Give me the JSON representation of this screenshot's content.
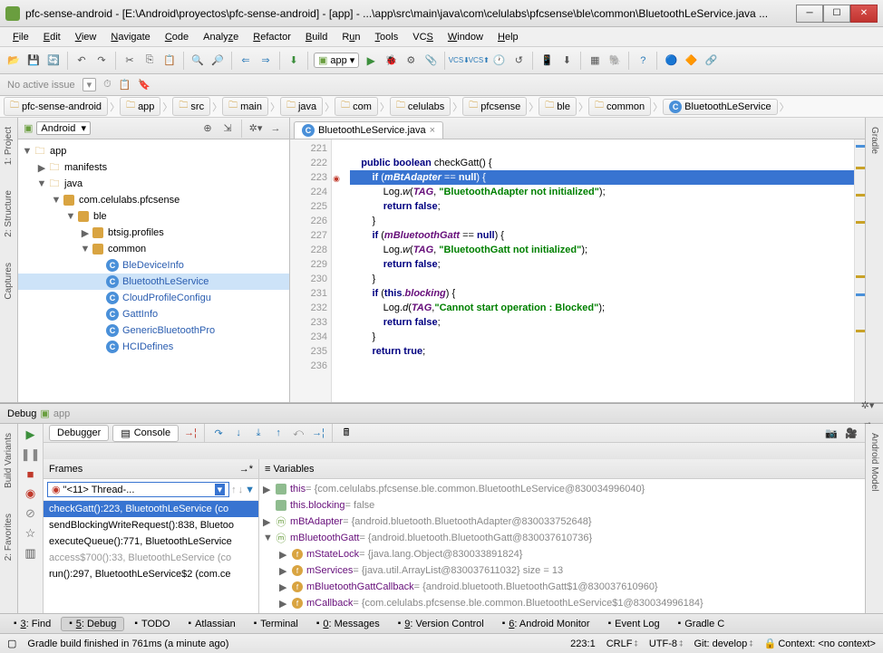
{
  "title": "pfc-sense-android - [E:\\Android\\proyectos\\pfc-sense-android] - [app] - ...\\app\\src\\main\\java\\com\\celulabs\\pfcsense\\ble\\common\\BluetoothLeService.java ...",
  "menu": [
    "File",
    "Edit",
    "View",
    "Navigate",
    "Code",
    "Analyze",
    "Refactor",
    "Build",
    "Run",
    "Tools",
    "VCS",
    "Window",
    "Help"
  ],
  "issue_text": "No active issue",
  "run_target": "app",
  "breadcrumbs": [
    "pfc-sense-android",
    "app",
    "src",
    "main",
    "java",
    "com",
    "celulabs",
    "pfcsense",
    "ble",
    "common",
    "BluetoothLeService"
  ],
  "project_view": "Android",
  "tree": {
    "root": "app",
    "manifests": "manifests",
    "java": "java",
    "pkg": "com.celulabs.pfcsense",
    "ble": "ble",
    "profiles": "btsig.profiles",
    "common": "common",
    "files": [
      "BleDeviceInfo",
      "BluetoothLeService",
      "CloudProfileConfigu",
      "GattInfo",
      "GenericBluetoothPro",
      "HCIDefines"
    ]
  },
  "editor_tab": "BluetoothLeService.java",
  "code_lines": [
    {
      "n": 221,
      "t": ""
    },
    {
      "n": 222,
      "t": "    public boolean checkGatt() {",
      "plain": true,
      "kw": [
        "public",
        "boolean"
      ]
    },
    {
      "n": 223,
      "t": "        if (mBtAdapter == null) {",
      "hl": true,
      "marked": true
    },
    {
      "n": 224,
      "t": "            Log.w(TAG, \"BluetoothAdapter not initialized\");",
      "log": true,
      "str": "\"BluetoothAdapter not initialized\""
    },
    {
      "n": 225,
      "t": "            return false;",
      "kw": [
        "return",
        "false"
      ]
    },
    {
      "n": 226,
      "t": "        }"
    },
    {
      "n": 227,
      "t": "        if (mBluetoothGatt == null) {",
      "kw": [
        "if",
        "null"
      ],
      "id": "mBluetoothGatt"
    },
    {
      "n": 228,
      "t": "            Log.w(TAG, \"BluetoothGatt not initialized\");",
      "log": true,
      "str": "\"BluetoothGatt not initialized\""
    },
    {
      "n": 229,
      "t": "            return false;",
      "kw": [
        "return",
        "false"
      ]
    },
    {
      "n": 230,
      "t": "        }"
    },
    {
      "n": 231,
      "t": "        if (this.blocking) {",
      "kw": [
        "if",
        "this"
      ],
      "id": "blocking"
    },
    {
      "n": 232,
      "t": "            Log.d(TAG,\"Cannot start operation : Blocked\");",
      "log": true,
      "str": "\"Cannot start operation : Blocked\""
    },
    {
      "n": 233,
      "t": "            return false;",
      "kw": [
        "return",
        "false"
      ]
    },
    {
      "n": 234,
      "t": "        }"
    },
    {
      "n": 235,
      "t": "        return true;",
      "kw": [
        "return",
        "true"
      ]
    },
    {
      "n": 236,
      "t": ""
    }
  ],
  "debug_title": "Debug",
  "debug_app": "app",
  "debug_tabs": {
    "debugger": "Debugger",
    "console": "Console"
  },
  "frames_title": "Frames",
  "vars_title": "Variables",
  "thread": "\"<11> Thread-...",
  "frames": [
    {
      "t": "checkGatt():223, BluetoothLeService (co",
      "sel": true
    },
    {
      "t": "sendBlockingWriteRequest():838, Bluetoo"
    },
    {
      "t": "executeQueue():771, BluetoothLeService"
    },
    {
      "t": "access$700():33, BluetoothLeService (co",
      "dis": true
    },
    {
      "t": "run():297, BluetoothLeService$2 (com.ce"
    }
  ],
  "vars": [
    {
      "ind": 0,
      "exp": "▶",
      "ic": "w",
      "n": "this",
      "v": " = {com.celulabs.pfcsense.ble.common.BluetoothLeService@830034996040}"
    },
    {
      "ind": 0,
      "exp": "",
      "ic": "w",
      "n": "this.blocking",
      "v": " = false"
    },
    {
      "ind": 0,
      "exp": "▶",
      "ic": "g",
      "n": "mBtAdapter",
      "v": " = {android.bluetooth.BluetoothAdapter@830033752648}"
    },
    {
      "ind": 0,
      "exp": "▼",
      "ic": "g",
      "n": "mBluetoothGatt",
      "v": " = {android.bluetooth.BluetoothGatt@830037610736}"
    },
    {
      "ind": 1,
      "exp": "▶",
      "ic": "f",
      "n": "mStateLock",
      "v": " = {java.lang.Object@830033891824}"
    },
    {
      "ind": 1,
      "exp": "▶",
      "ic": "f",
      "n": "mServices",
      "v": " = {java.util.ArrayList@830037611032}  size = 13"
    },
    {
      "ind": 1,
      "exp": "▶",
      "ic": "f",
      "n": "mBluetoothGattCallback",
      "v": " = {android.bluetooth.BluetoothGatt$1@830037610960}"
    },
    {
      "ind": 1,
      "exp": "▶",
      "ic": "f",
      "n": "mCallback",
      "v": " = {com.celulabs.pfcsense.ble.common.BluetoothLeService$1@830034996184}"
    }
  ],
  "bottom_tabs": [
    {
      "l": "3: Find",
      "u": "3"
    },
    {
      "l": "5: Debug",
      "u": "5",
      "active": true
    },
    {
      "l": "TODO"
    },
    {
      "l": "Atlassian"
    },
    {
      "l": "Terminal"
    },
    {
      "l": "0: Messages",
      "u": "0"
    },
    {
      "l": "9: Version Control",
      "u": "9"
    },
    {
      "l": "6: Android Monitor",
      "u": "6"
    },
    {
      "l": "Event Log"
    },
    {
      "l": "Gradle C"
    }
  ],
  "left_vtabs": [
    "1: Project",
    "2: Structure",
    "Captures"
  ],
  "left_vtabs2": [
    "Build Variants",
    "2: Favorites"
  ],
  "right_vtabs": [
    "Gradle"
  ],
  "right_vtabs2": [
    "Android Model"
  ],
  "status": {
    "msg": "Gradle build finished in 761ms (a minute ago)",
    "pos": "223:1",
    "eol": "CRLF",
    "enc": "UTF-8",
    "git": "Git: develop",
    "ctx": "Context: <no context>"
  }
}
